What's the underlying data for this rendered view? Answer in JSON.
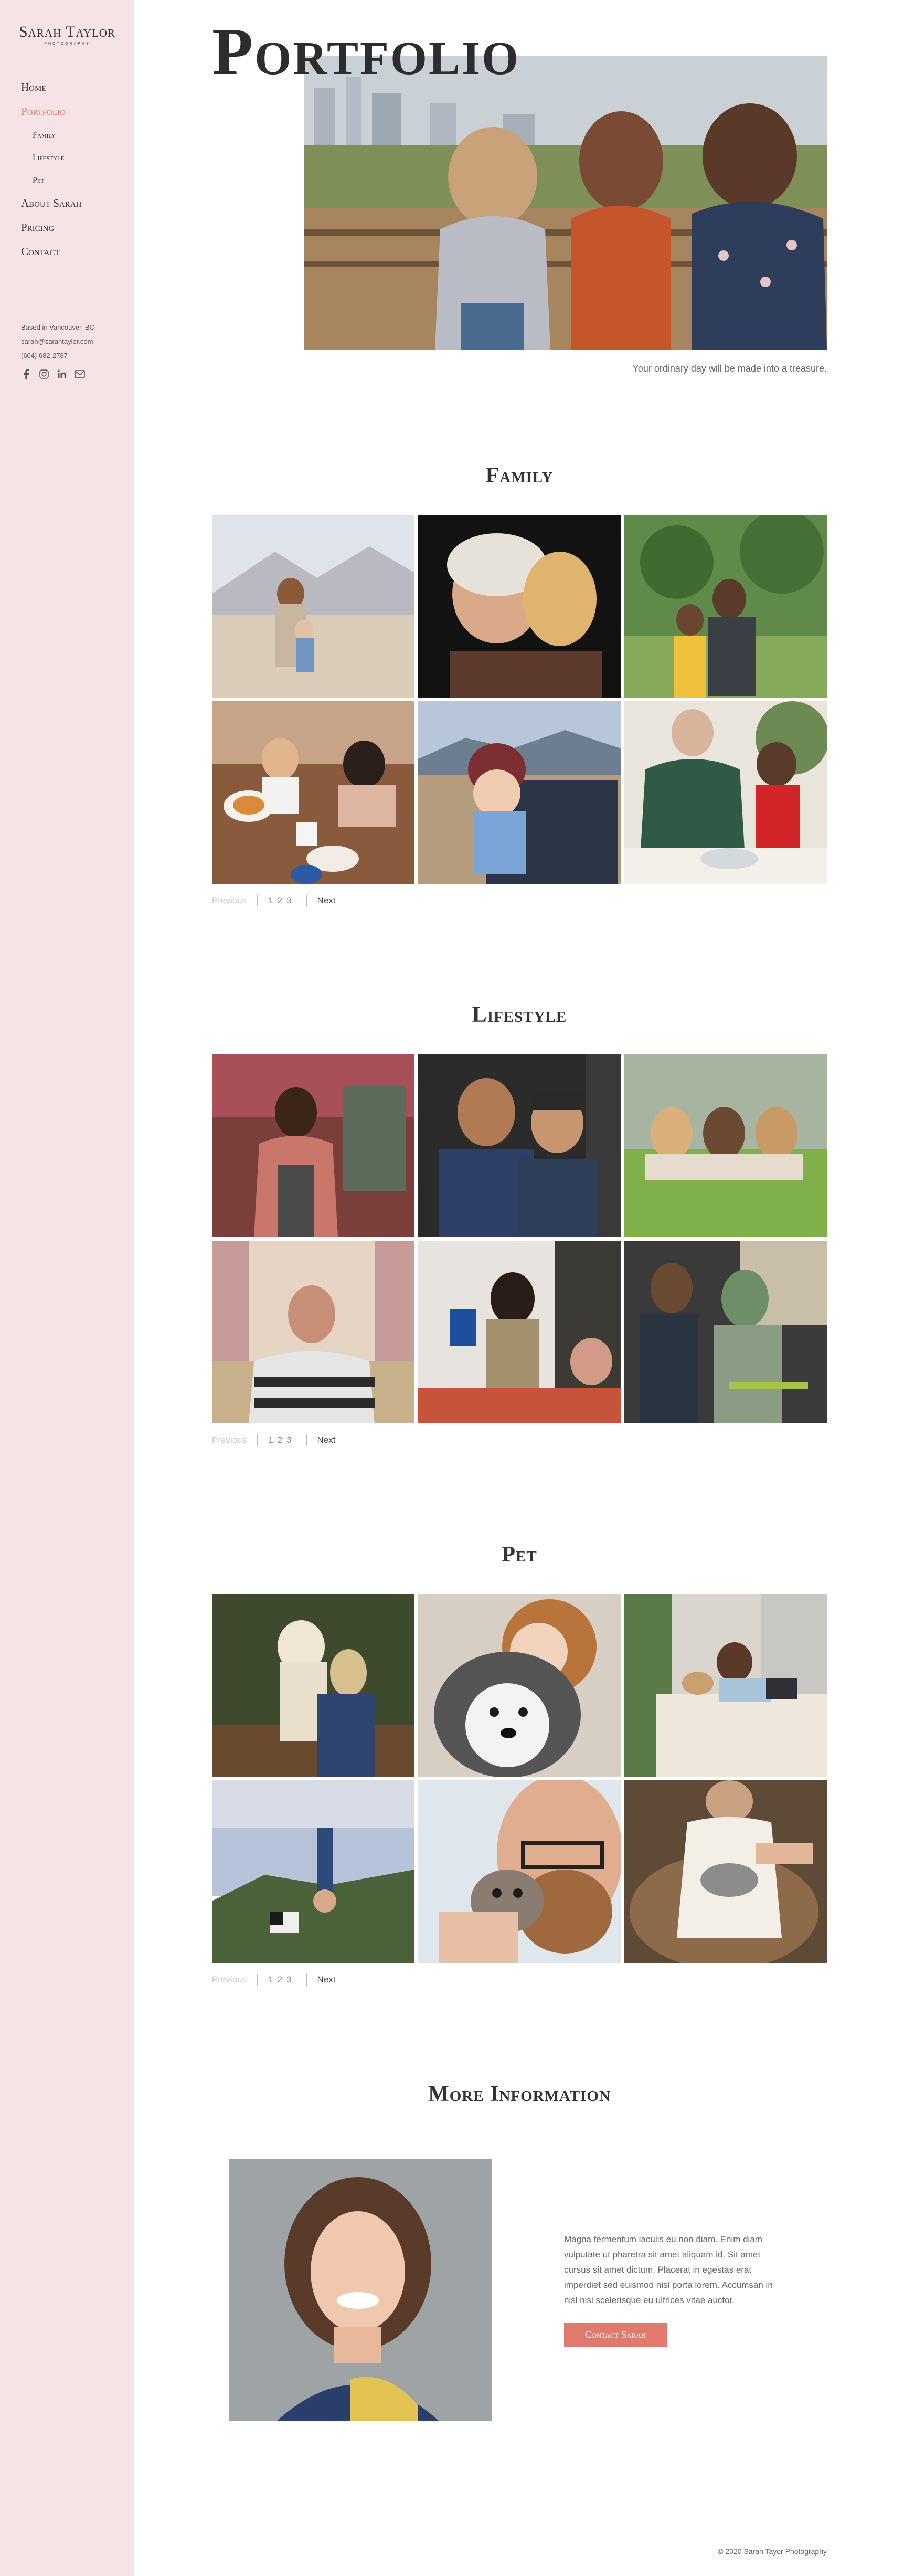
{
  "brand": {
    "name": "Sarah Taylor",
    "sub": "PHOTOGRAPHY"
  },
  "nav": [
    {
      "label": "Home",
      "active": false,
      "sub": false
    },
    {
      "label": "Portfolio",
      "active": true,
      "sub": false
    },
    {
      "label": "Family",
      "active": false,
      "sub": true
    },
    {
      "label": "Lifestyle",
      "active": false,
      "sub": true
    },
    {
      "label": "Pet",
      "active": false,
      "sub": true
    },
    {
      "label": "About Sarah",
      "active": false,
      "sub": false
    },
    {
      "label": "Pricing",
      "active": false,
      "sub": false
    },
    {
      "label": "Contact",
      "active": false,
      "sub": false
    }
  ],
  "contact": {
    "location": "Based in Vancouver, BC",
    "email": "sarah@sarahtaylor.com",
    "phone": "(604) 682-2787"
  },
  "social_icons": [
    "facebook-icon",
    "instagram-icon",
    "linkedin-icon",
    "mail-icon"
  ],
  "hero": {
    "title": "Portfolio",
    "caption": "Your ordinary day will be made into a treasure."
  },
  "sections": [
    {
      "title": "Family",
      "pager": {
        "previous": "Previous",
        "pages": [
          "1",
          "2",
          "3"
        ],
        "next": "Next"
      }
    },
    {
      "title": "Lifestyle",
      "pager": {
        "previous": "Previous",
        "pages": [
          "1",
          "2",
          "3"
        ],
        "next": "Next"
      }
    },
    {
      "title": "Pet",
      "pager": {
        "previous": "Previous",
        "pages": [
          "1",
          "2",
          "3"
        ],
        "next": "Next"
      }
    }
  ],
  "more_info": {
    "title": "More Information",
    "paragraph": "Magna fermentum iaculis eu non diam. Enim diam vulputate ut pharetra sit amet aliquam id. Sit amet cursus sit amet dictum. Placerat in egestas erat imperdiet sed euismod nisi porta lorem. Accumsan in nisl nisi scelerisque eu ultrices vitae auctor.",
    "button": "Contact Sarah"
  },
  "footer": "© 2020 Sarah Tayor Photography",
  "colors": {
    "sidebar_bg": "#f5e3e5",
    "accent": "#e07a6e",
    "text": "#333333"
  }
}
